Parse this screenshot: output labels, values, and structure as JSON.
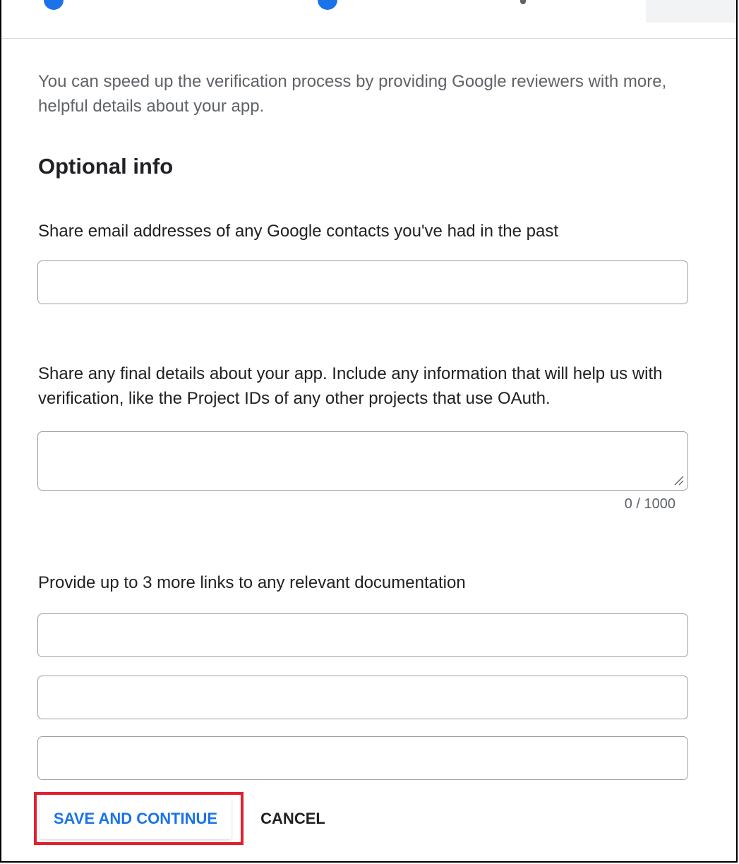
{
  "intro_text": "You can speed up the verification process by providing Google reviewers with more, helpful details about your app.",
  "section_title": "Optional info",
  "contacts": {
    "label": "Share email addresses of any Google contacts you've had in the past",
    "value": ""
  },
  "final_details": {
    "label": "Share any final details about your app. Include any information that will help us with verification, like the Project IDs of any other projects that use OAuth.",
    "value": "",
    "counter": "0 / 1000"
  },
  "links": {
    "label": "Provide up to 3 more links to any relevant documentation",
    "values": [
      "",
      "",
      ""
    ]
  },
  "actions": {
    "save_label": "SAVE AND CONTINUE",
    "cancel_label": "CANCEL"
  },
  "colors": {
    "accent": "#1a73e8",
    "highlight": "#e0202f"
  }
}
